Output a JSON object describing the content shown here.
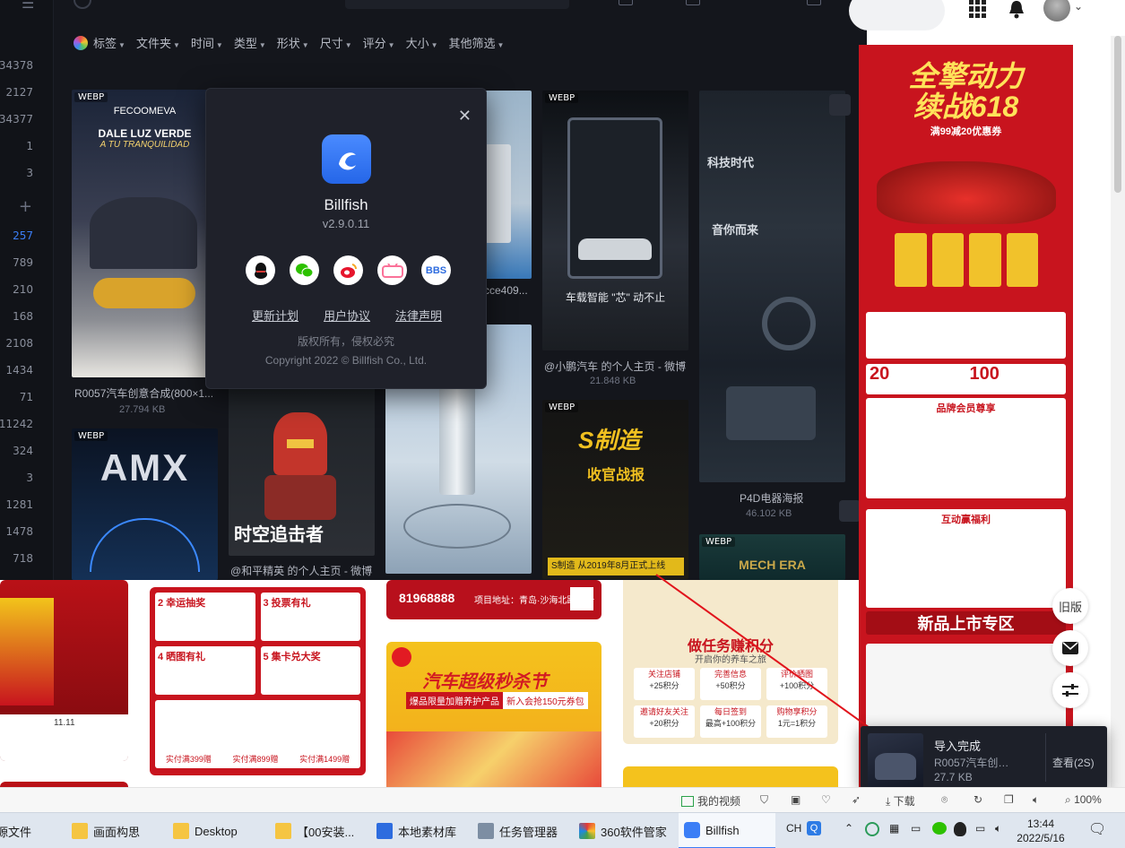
{
  "app": {
    "sidebar_counts": [
      "34378",
      "2127",
      "34377",
      "1",
      "3",
      "257",
      "789",
      "210",
      "168",
      "2108",
      "1434",
      "71",
      "11242",
      "324",
      "3",
      "1281",
      "1478",
      "718"
    ],
    "filters": [
      "标签",
      "文件夹",
      "时间",
      "类型",
      "形状",
      "尺寸",
      "评分",
      "大小",
      "其他筛选"
    ],
    "thumbnails": [
      {
        "tag": "WEBP",
        "caption": "R0057汽车创意合成(800×1...",
        "size": "27.794 KB"
      },
      {
        "tag": "",
        "caption": "cce409...",
        "size": ""
      },
      {
        "tag": "WEBP",
        "caption": "@小鹏汽车 的个人主页 - 微博",
        "size": "21.848 KB"
      },
      {
        "tag": "",
        "caption": "P4D电器海报",
        "size": "46.102 KB"
      },
      {
        "tag": "WEBP",
        "caption": "",
        "size": ""
      },
      {
        "tag": "",
        "caption": "@和平精英 的个人主页 - 微博",
        "size": ""
      },
      {
        "tag": "WEBP",
        "caption": "",
        "size": ""
      },
      {
        "tag": "WEBP",
        "caption": "",
        "size": ""
      }
    ],
    "thumb_texts": {
      "amx": "AMX",
      "dale": "DALE LUZ VERDE",
      "tranq": "A TU TRANQUILIDAD",
      "feco": "FECOOMEVA",
      "shiji": "时空追击者",
      "kejihua": "科技时代",
      "yinyue": "音你而来",
      "pengcheng": "车载智能 \"芯\" 动不止",
      "zhi": "S制造",
      "shouguan": "收官战报",
      "mech": "MECH ERA",
      "zhengshi": "S制造 从2019年8月正式上线"
    }
  },
  "about": {
    "app_name": "Billfish",
    "version": "v2.9.0.11",
    "socials": [
      "QQ",
      "WeChat",
      "Weibo",
      "Bilibili",
      "BBS"
    ],
    "bbs_label": "BBS",
    "links": [
      "更新计划",
      "用户协议",
      "法律声明"
    ],
    "rights": "版权所有，侵权必究",
    "copyright": "Copyright 2022 © Billfish Co., Ltd."
  },
  "browser": {
    "promo_title1": "全擎动力",
    "promo_title2": "续战618",
    "promo_sub": "满99减20优惠券",
    "brand_head": "品牌会员尊享",
    "interact_head": "互动赢福利",
    "new_zone": "新品上市专区",
    "coupon1": "20",
    "coupon2": "100",
    "side_old": "旧版",
    "lower": {
      "phone": "81968888",
      "addr": "项目地址：青岛·沙海北路58号",
      "sale_title": "汽车超级秒杀节",
      "sale_sub": "爆品限量加赠养护产品",
      "sale_coupon": "新入会抢150元券包",
      "task_title": "做任务赚积分",
      "task_sub": "开启你的养车之旅",
      "tasks": [
        "关注店铺",
        "完善信息",
        "评价晒图",
        "邀请好友关注",
        "每日签到",
        "购物享积分"
      ],
      "task_points": [
        "+25积分",
        "+50积分",
        "+100积分",
        "+20积分",
        "最高+100积分",
        "1元=1积分"
      ],
      "lottery": [
        "2 幸运抽奖",
        "3 投票有礼",
        "4 晒图有礼",
        "5 集卡兑大奖"
      ],
      "lottery_prizes": [
        "实付满399赠",
        "实付满899赠",
        "实付满1499赠"
      ],
      "date": "11.11"
    }
  },
  "toast": {
    "title": "导入完成",
    "filename": "R0057汽车创意合成(800×1...",
    "size": "27.7 KB",
    "view": "查看(2S)"
  },
  "statusbar": {
    "my_video": "我的视频",
    "download": "下载",
    "zoom": "100%"
  },
  "taskbar": {
    "apps": [
      "画面构思",
      "Desktop",
      "【00安装...",
      "本地素材库",
      "任务管理器",
      "360软件管家",
      "Billfish"
    ],
    "partial": "源文件",
    "ime": "CH",
    "time": "13:44",
    "date": "2022/5/16"
  },
  "colors": {
    "accent": "#3b7ef6",
    "app_bg": "#14161c",
    "dialog_bg": "#1f212a",
    "promo_red": "#c8141e"
  }
}
